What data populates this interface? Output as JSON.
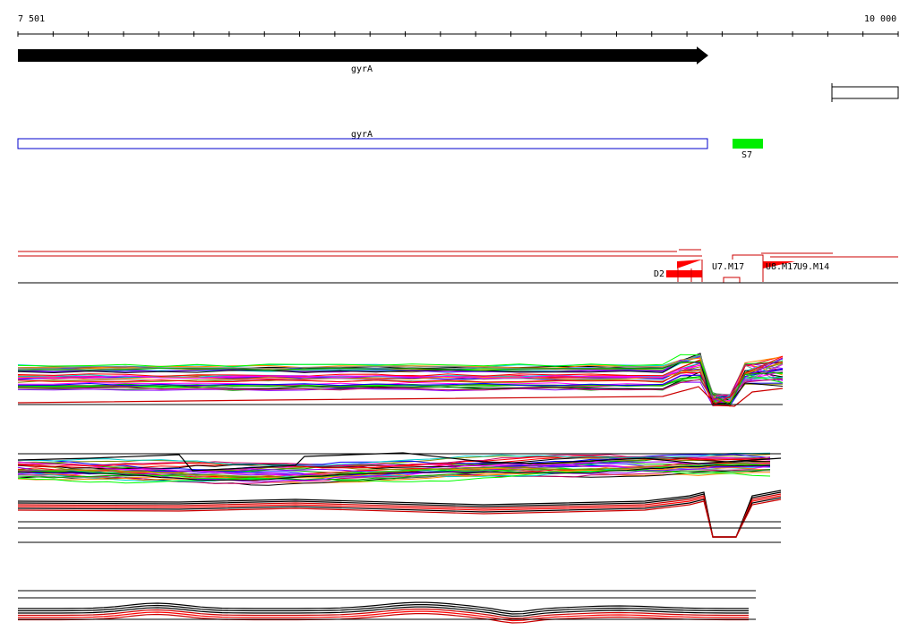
{
  "ruler": {
    "start_label": "7 501",
    "end_label": "10 000"
  },
  "features": {
    "gene_arrow_label": "gyrA",
    "cds_box_label": "gyrA",
    "site_label": "S7",
    "repeat_labels": [
      "D2",
      "U7.M17",
      "U8.M17",
      "U9.M14"
    ]
  },
  "colors": {
    "gene_arrow": "#000000",
    "cds_box": "#0000cc",
    "site": "#00ee00",
    "repeat": "#ff0000",
    "track_axis": "#000000",
    "trace_palette": [
      "#ff0000",
      "#00aa00",
      "#0000ff",
      "#ff00ff",
      "#00cccc",
      "#ff8800",
      "#888800",
      "#8800ff",
      "#00ff00",
      "#000000",
      "#888888",
      "#cc0066"
    ]
  },
  "icons": {
    "ruler": "scale-ruler",
    "gene": "gene-arrow-icon",
    "legend_box": "empty-box-icon"
  }
}
